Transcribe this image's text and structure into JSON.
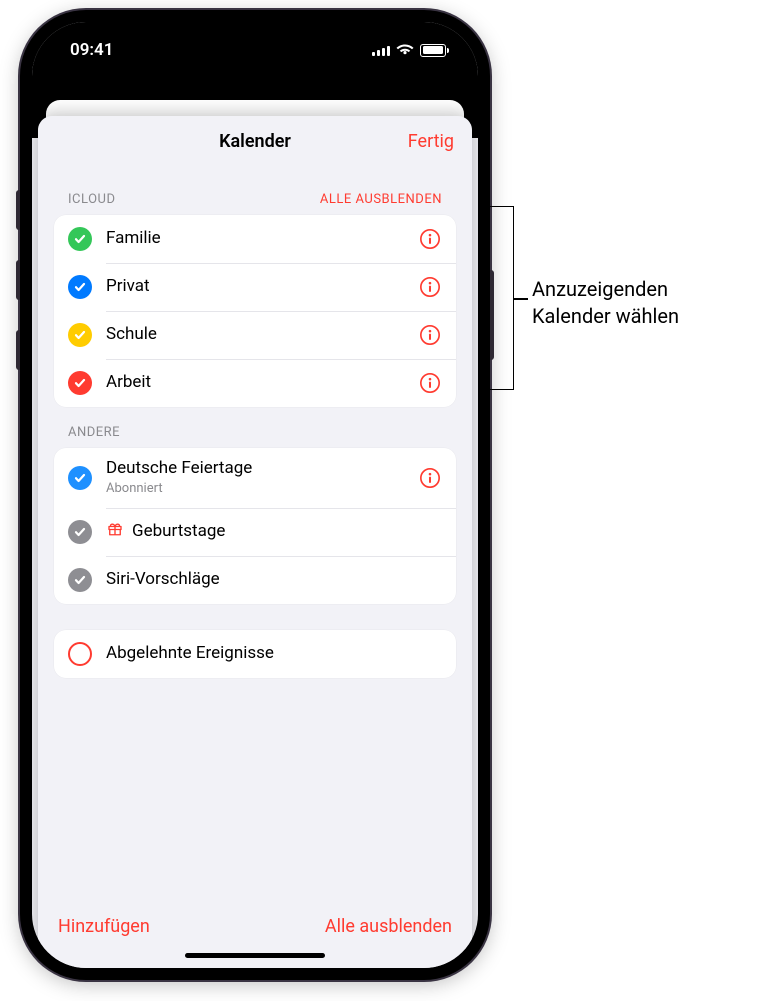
{
  "statusbar": {
    "time": "09:41"
  },
  "sheet": {
    "title": "Kalender",
    "done_label": "Fertig"
  },
  "sections": {
    "icloud": {
      "header": "ICLOUD",
      "action": "ALLE AUSBLENDEN",
      "items": [
        {
          "label": "Familie",
          "color": "#34c759",
          "checked": true,
          "has_info": true
        },
        {
          "label": "Privat",
          "color": "#007aff",
          "checked": true,
          "has_info": true
        },
        {
          "label": "Schule",
          "color": "#ffcc00",
          "checked": true,
          "has_info": true
        },
        {
          "label": "Arbeit",
          "color": "#ff3b30",
          "checked": true,
          "has_info": true
        }
      ]
    },
    "other": {
      "header": "ANDERE",
      "items": [
        {
          "label": "Deutsche Feiertage",
          "sublabel": "Abonniert",
          "color": "#1e90ff",
          "checked": true,
          "has_info": true
        },
        {
          "label": "Geburtstage",
          "color": "#8e8e93",
          "checked": true,
          "has_info": false,
          "icon": "gift"
        },
        {
          "label": "Siri-Vorschläge",
          "color": "#8e8e93",
          "checked": true,
          "has_info": false
        }
      ]
    },
    "declined": {
      "items": [
        {
          "label": "Abgelehnte Ereignisse",
          "color": "#ff3b30",
          "checked": false,
          "has_info": false
        }
      ]
    }
  },
  "bottom": {
    "add_label": "Hinzufügen",
    "hide_all_label": "Alle ausblenden"
  },
  "callout": {
    "line1": "Anzuzeigenden",
    "line2": "Kalender wählen"
  }
}
